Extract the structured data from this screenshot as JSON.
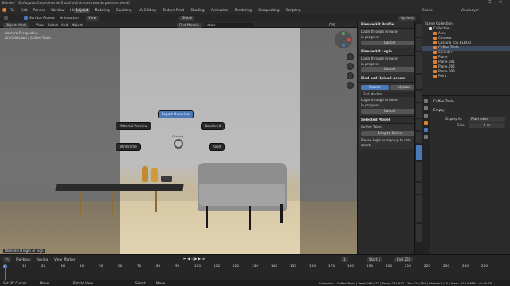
{
  "window": {
    "title": "Blender* [D:\\Augusto Cesar\\Area de Trabalho\\finervous\\cena de preteste.blend]"
  },
  "menu": {
    "items": [
      "File",
      "Edit",
      "Render",
      "Window",
      "Help"
    ]
  },
  "workspaces": [
    "Layout",
    "Modeling",
    "Sculpting",
    "UV Editing",
    "Texture Paint",
    "Shading",
    "Animation",
    "Rendering",
    "Compositing",
    "Scripting"
  ],
  "active_workspace": "Layout",
  "scene": {
    "label": "Scene",
    "view_layer": "View Layer"
  },
  "header": {
    "surface_project": "Surface Project",
    "orientation": "Orientation",
    "view": "View",
    "transform_global": "Global",
    "options": "Options"
  },
  "viewport_header": {
    "mode": "Object Mode",
    "view": "View",
    "select": "Select",
    "add": "Add",
    "object": "Object",
    "find_models": "Find Models",
    "search_value": "chair",
    "fps": "FPS",
    "at_track": "At Track",
    "frame_rate": "30.00"
  },
  "overlay": {
    "perspective": "Camera Perspective",
    "collection": "(1) Collection | Coffee Table"
  },
  "pie_menu": {
    "expert_overview": "Export Overview",
    "material_preview": "Material Preview",
    "rendered": "Rendered",
    "wireframe": "Wireframe",
    "solid": "Solid",
    "center": "Shading"
  },
  "addon_panel": {
    "profile_title": "Blenderkit Profile",
    "login_browser": "Login through browser",
    "in_progress": "in progress",
    "cancel": "Cancel",
    "login_title": "Blenderkit Login",
    "find_upload_title": "Find and Upload Assets",
    "search_tab": "Search",
    "upload_tab": "Upload",
    "find_models": "Find Models",
    "selected_model_title": "Selected Model",
    "selected_name": "Coffee Table",
    "bring_to_scene": "Bring to Scene",
    "login_note": "Please login or sign up to rate assets"
  },
  "vertical_tabs": [
    "Tool",
    "View",
    "Blenderkit",
    "Create",
    "Edit",
    "Physics",
    "Edit",
    "Item",
    "BlenderKit",
    "Checker Deselect",
    "Create",
    "Checkout Model Prev",
    "The Entrei"
  ],
  "outliner": {
    "title": "Scene Collection",
    "items": [
      "Collection",
      "Area",
      "Camera",
      "Cassina 255 ELBOO",
      "Coffee Table",
      "Cylinder",
      "Plane",
      "Plane.001",
      "Plane.002",
      "Plane.003",
      "Point"
    ]
  },
  "properties": {
    "object_name": "Coffee Table",
    "section": "Empty",
    "display_as_label": "Display As",
    "display_as_value": "Plain Axes",
    "size_label": "Size",
    "size_value": "1 m"
  },
  "timeline": {
    "playback": "Playback",
    "keying": "Keying",
    "view": "View",
    "marker": "Marker",
    "current_frame": "1",
    "start_label": "Start",
    "start_value": "1",
    "end_label": "End",
    "end_value": "250",
    "ticks": [
      "0",
      "10",
      "20",
      "30",
      "40",
      "50",
      "60",
      "70",
      "80",
      "90",
      "100",
      "110",
      "120",
      "130",
      "140",
      "150",
      "160",
      "170",
      "180",
      "190",
      "200",
      "210",
      "220",
      "230",
      "240",
      "250"
    ]
  },
  "notification": "Blenderkit login or sign",
  "status": {
    "left": [
      "Set 3D Cursor",
      "Move",
      "Rotate View",
      "Select",
      "Move"
    ],
    "right": "Collection | Coffee Table | Verts:268,072 | Faces:261,632 | Tris:523,264 | Objects:1/10 | Mem: 316.9 MiB | v2.80.75"
  },
  "colors": {
    "accent": "#4a78b8",
    "orange": "#e0822e",
    "green": "#58a868"
  }
}
